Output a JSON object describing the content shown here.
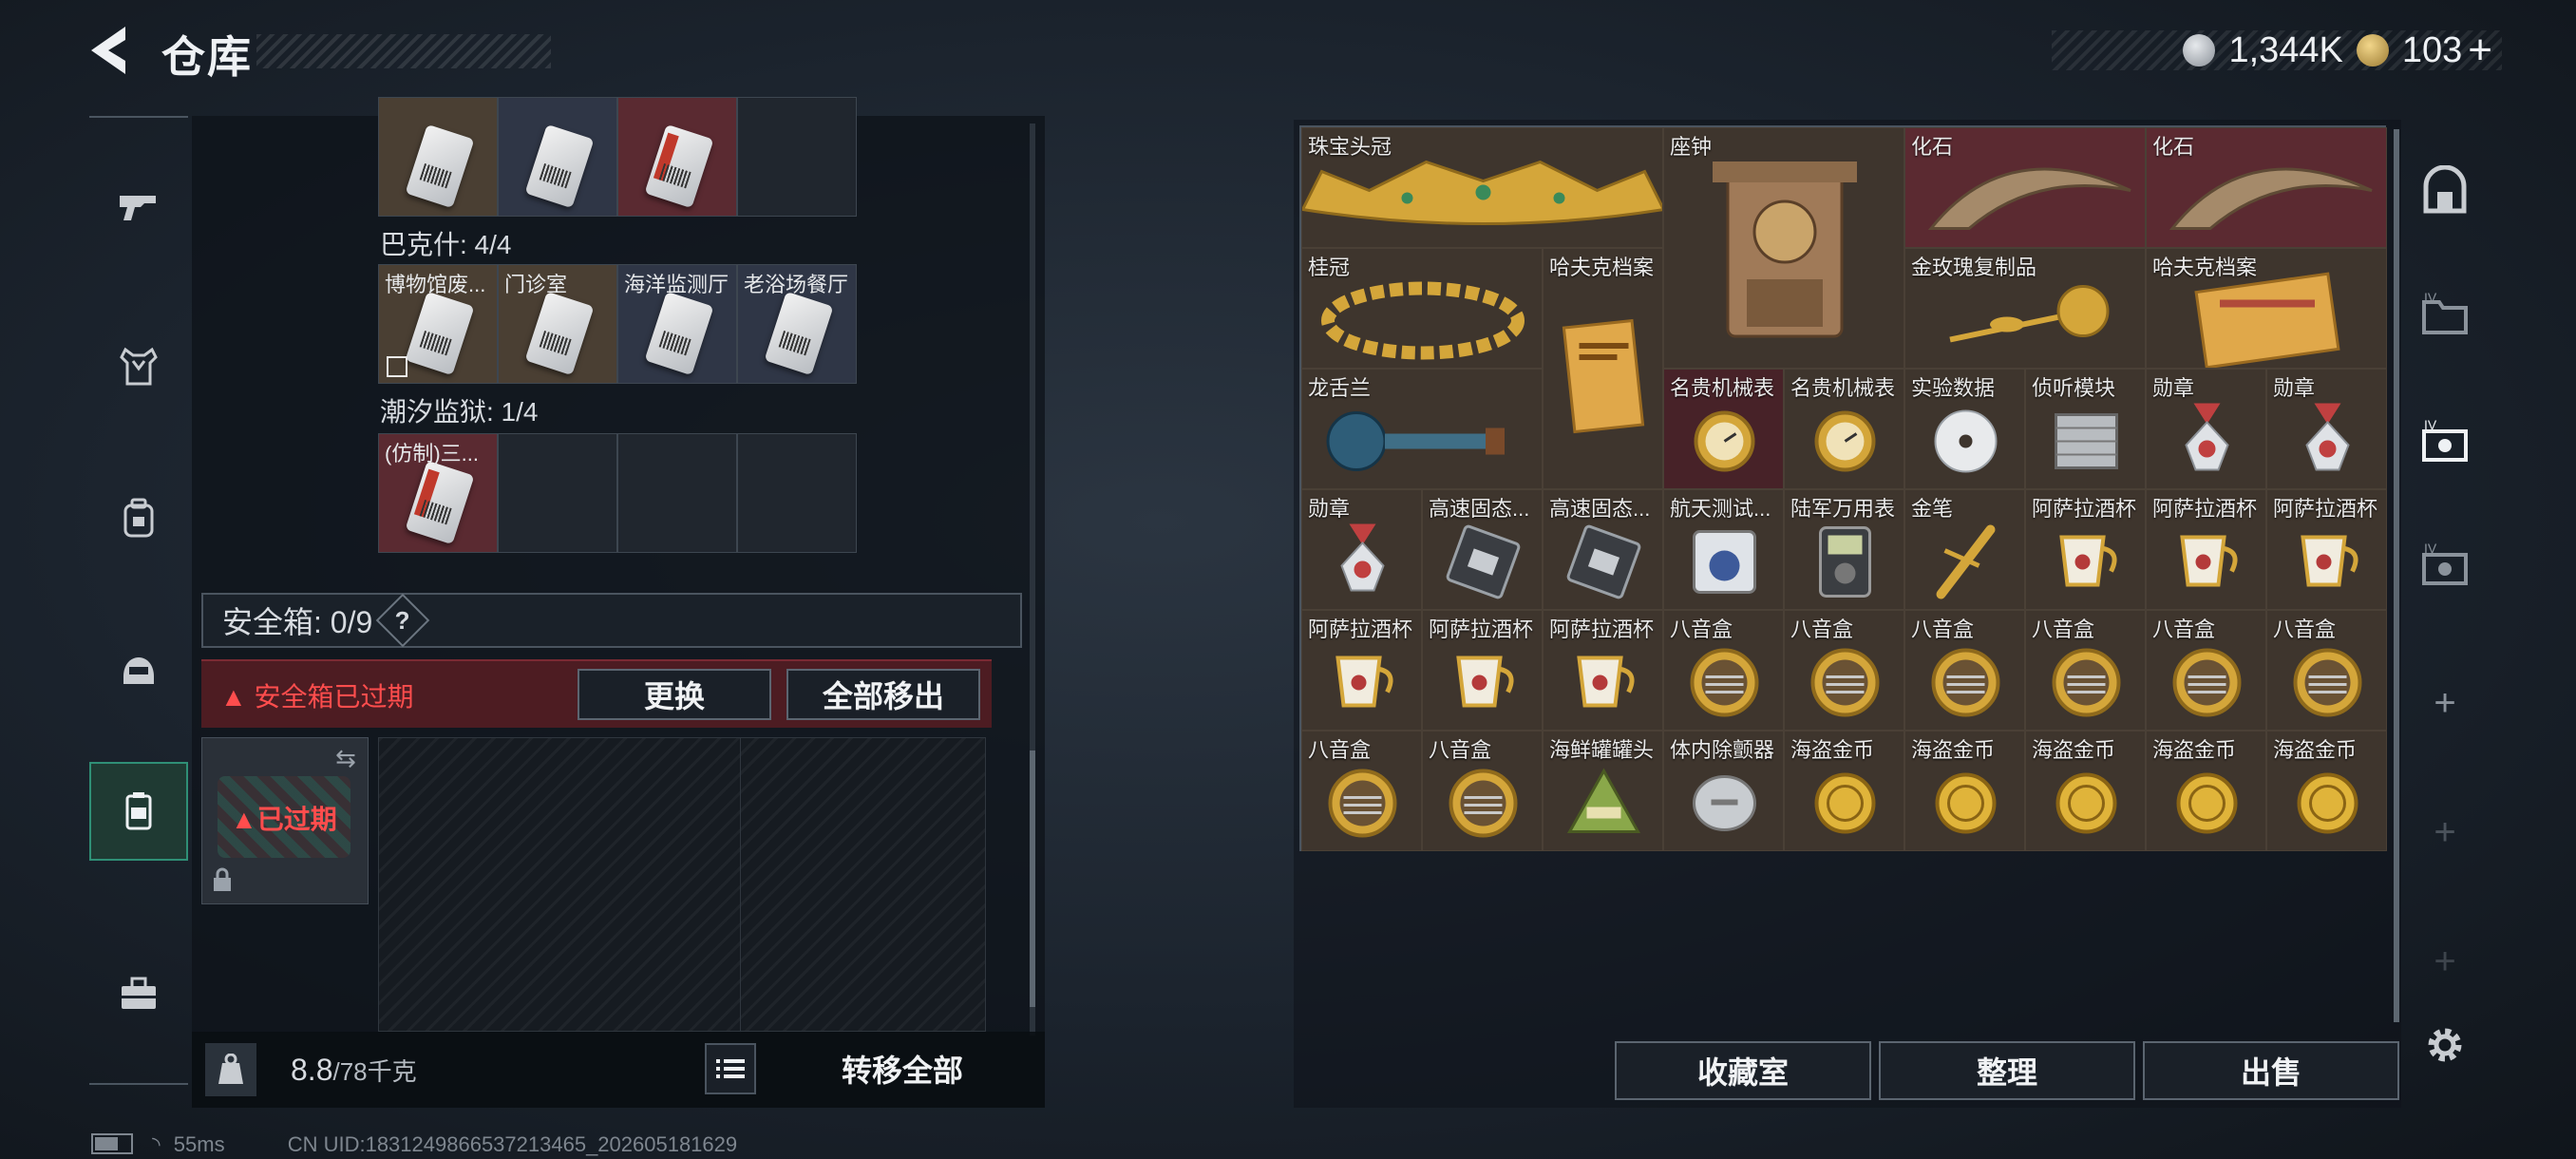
{
  "header": {
    "title": "仓库",
    "currency_main": "1,344K",
    "currency_secondary": "103",
    "add_symbol": "+"
  },
  "left_panel": {
    "row1_cells": [
      {
        "label": "",
        "bg": "brown",
        "keycard": true
      },
      {
        "label": "",
        "bg": "navy",
        "keycard": true
      },
      {
        "label": "",
        "bg": "red",
        "keycard": true
      },
      {
        "label": "",
        "bg": "dark",
        "keycard": false
      }
    ],
    "section_bakesh": "巴克什: 4/4",
    "row2_cells": [
      {
        "label": "博物馆废...",
        "bg": "brown",
        "keycard": true
      },
      {
        "label": "门诊室",
        "bg": "brown",
        "keycard": true
      },
      {
        "label": "海洋监测厅",
        "bg": "navy",
        "keycard": true
      },
      {
        "label": "老浴场餐厅",
        "bg": "navy",
        "keycard": true
      }
    ],
    "section_chaoxi": "潮汐监狱: 1/4",
    "row3_cells": [
      {
        "label": "(仿制)三...",
        "bg": "red",
        "keycard": true
      },
      {
        "label": "",
        "bg": "dark",
        "keycard": false
      },
      {
        "label": "",
        "bg": "dark",
        "keycard": false
      },
      {
        "label": "",
        "bg": "dark",
        "keycard": false
      }
    ],
    "safebox_label": "安全箱: 0/9",
    "help_label": "?",
    "expired_warning": "安全箱已过期",
    "replace_button": "更换",
    "move_all_out_button": "全部移出",
    "expired_badge": "已过期",
    "weight_current": "8.8",
    "weight_max": "/78千克",
    "transfer_all_button": "转移全部"
  },
  "stash": {
    "items": [
      {
        "label": "珠宝头冠",
        "c": 0,
        "r": 0,
        "w": 3,
        "h": 1,
        "bg": "c-brown",
        "art": "crown"
      },
      {
        "label": "座钟",
        "c": 3,
        "r": 0,
        "w": 2,
        "h": 2,
        "bg": "c-brown",
        "art": "clock"
      },
      {
        "label": "化石",
        "c": 5,
        "r": 0,
        "w": 2,
        "h": 1,
        "bg": "c-red",
        "art": "fossil"
      },
      {
        "label": "化石",
        "c": 7,
        "r": 0,
        "w": 2,
        "h": 1,
        "bg": "c-red",
        "art": "fossil"
      },
      {
        "label": "桂冠",
        "c": 0,
        "r": 1,
        "w": 2,
        "h": 1,
        "bg": "c-brown",
        "art": "laurel"
      },
      {
        "label": "哈夫克档案",
        "c": 2,
        "r": 1,
        "w": 1,
        "h": 2,
        "bg": "c-brown",
        "art": "file"
      },
      {
        "label": "金玫瑰复制品",
        "c": 5,
        "r": 1,
        "w": 2,
        "h": 1,
        "bg": "c-brown",
        "art": "rose"
      },
      {
        "label": "哈夫克档案",
        "c": 7,
        "r": 1,
        "w": 2,
        "h": 1,
        "bg": "c-brown",
        "art": "file2"
      },
      {
        "label": "龙舌兰",
        "c": 0,
        "r": 2,
        "w": 2,
        "h": 1,
        "bg": "c-brown",
        "art": "bottle"
      },
      {
        "label": "名贵机械表",
        "c": 3,
        "r": 2,
        "w": 1,
        "h": 1,
        "bg": "c-darkred",
        "art": "watch"
      },
      {
        "label": "名贵机械表",
        "c": 4,
        "r": 2,
        "w": 1,
        "h": 1,
        "bg": "c-brown",
        "art": "watch"
      },
      {
        "label": "实验数据",
        "c": 5,
        "r": 2,
        "w": 1,
        "h": 1,
        "bg": "c-brown",
        "art": "disc"
      },
      {
        "label": "侦听模块",
        "c": 6,
        "r": 2,
        "w": 1,
        "h": 1,
        "bg": "c-brown",
        "art": "module"
      },
      {
        "label": "勋章",
        "c": 7,
        "r": 2,
        "w": 1,
        "h": 1,
        "bg": "c-brown",
        "art": "medal"
      },
      {
        "label": "勋章",
        "c": 8,
        "r": 2,
        "w": 1,
        "h": 1,
        "bg": "c-brown",
        "art": "medal"
      },
      {
        "label": "勋章",
        "c": 0,
        "r": 3,
        "w": 1,
        "h": 1,
        "bg": "c-brown",
        "art": "medal"
      },
      {
        "label": "高速固态...",
        "c": 1,
        "r": 3,
        "w": 1,
        "h": 1,
        "bg": "c-brown",
        "art": "ssd"
      },
      {
        "label": "高速固态...",
        "c": 2,
        "r": 3,
        "w": 1,
        "h": 1,
        "bg": "c-brown",
        "art": "ssd"
      },
      {
        "label": "航天测试...",
        "c": 3,
        "r": 3,
        "w": 1,
        "h": 1,
        "bg": "c-brown",
        "art": "device"
      },
      {
        "label": "陆军万用表",
        "c": 4,
        "r": 3,
        "w": 1,
        "h": 1,
        "bg": "c-brown",
        "art": "meter"
      },
      {
        "label": "金笔",
        "c": 5,
        "r": 3,
        "w": 1,
        "h": 1,
        "bg": "c-brown",
        "art": "pen"
      },
      {
        "label": "阿萨拉酒杯",
        "c": 6,
        "r": 3,
        "w": 1,
        "h": 1,
        "bg": "c-brown",
        "art": "cup"
      },
      {
        "label": "阿萨拉酒杯",
        "c": 7,
        "r": 3,
        "w": 1,
        "h": 1,
        "bg": "c-brown",
        "art": "cup"
      },
      {
        "label": "阿萨拉酒杯",
        "c": 8,
        "r": 3,
        "w": 1,
        "h": 1,
        "bg": "c-brown",
        "art": "cup"
      },
      {
        "label": "阿萨拉酒杯",
        "c": 0,
        "r": 4,
        "w": 1,
        "h": 1,
        "bg": "c-brown",
        "art": "cup"
      },
      {
        "label": "阿萨拉酒杯",
        "c": 1,
        "r": 4,
        "w": 1,
        "h": 1,
        "bg": "c-brown",
        "art": "cup"
      },
      {
        "label": "阿萨拉酒杯",
        "c": 2,
        "r": 4,
        "w": 1,
        "h": 1,
        "bg": "c-brown",
        "art": "cup"
      },
      {
        "label": "八音盒",
        "c": 3,
        "r": 4,
        "w": 1,
        "h": 1,
        "bg": "c-brown",
        "art": "musicbox"
      },
      {
        "label": "八音盒",
        "c": 4,
        "r": 4,
        "w": 1,
        "h": 1,
        "bg": "c-brown",
        "art": "musicbox"
      },
      {
        "label": "八音盒",
        "c": 5,
        "r": 4,
        "w": 1,
        "h": 1,
        "bg": "c-brown",
        "art": "musicbox"
      },
      {
        "label": "八音盒",
        "c": 6,
        "r": 4,
        "w": 1,
        "h": 1,
        "bg": "c-brown",
        "art": "musicbox"
      },
      {
        "label": "八音盒",
        "c": 7,
        "r": 4,
        "w": 1,
        "h": 1,
        "bg": "c-brown",
        "art": "musicbox"
      },
      {
        "label": "八音盒",
        "c": 8,
        "r": 4,
        "w": 1,
        "h": 1,
        "bg": "c-brown",
        "art": "musicbox"
      },
      {
        "label": "八音盒",
        "c": 0,
        "r": 5,
        "w": 1,
        "h": 1,
        "bg": "c-brown",
        "art": "musicbox"
      },
      {
        "label": "八音盒",
        "c": 1,
        "r": 5,
        "w": 1,
        "h": 1,
        "bg": "c-brown",
        "art": "musicbox"
      },
      {
        "label": "海鲜罐罐头",
        "c": 2,
        "r": 5,
        "w": 1,
        "h": 1,
        "bg": "c-brown",
        "art": "can"
      },
      {
        "label": "体内除颤器",
        "c": 3,
        "r": 5,
        "w": 1,
        "h": 1,
        "bg": "c-brown",
        "art": "defib"
      },
      {
        "label": "海盗金币",
        "c": 4,
        "r": 5,
        "w": 1,
        "h": 1,
        "bg": "c-brown",
        "art": "coin"
      },
      {
        "label": "海盗金币",
        "c": 5,
        "r": 5,
        "w": 1,
        "h": 1,
        "bg": "c-brown",
        "art": "coin"
      },
      {
        "label": "海盗金币",
        "c": 6,
        "r": 5,
        "w": 1,
        "h": 1,
        "bg": "c-brown",
        "art": "coin"
      },
      {
        "label": "海盗金币",
        "c": 7,
        "r": 5,
        "w": 1,
        "h": 1,
        "bg": "c-brown",
        "art": "coin"
      },
      {
        "label": "海盗金币",
        "c": 8,
        "r": 5,
        "w": 1,
        "h": 1,
        "bg": "c-brown",
        "art": "coin"
      }
    ]
  },
  "bottom_right": {
    "collection_button": "收藏室",
    "organize_button": "整理",
    "sell_button": "出售"
  },
  "status": {
    "ping": "55ms",
    "uid": "CN UID:1831249866537213465_202605181629"
  },
  "colors": {
    "accent_green": "#2f8f76",
    "warning_red": "#ff4d4d",
    "expired_bg": "#4d1c22"
  }
}
